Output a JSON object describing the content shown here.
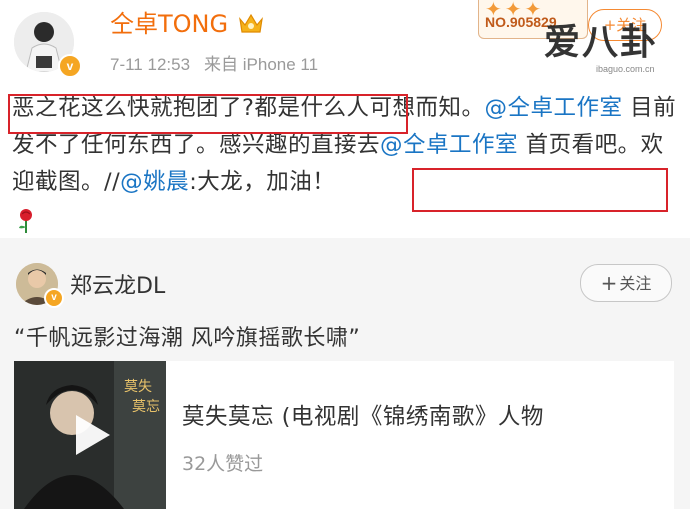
{
  "header": {
    "username": "仝卓TONG",
    "timestamp": "7-11 12:53",
    "source": "来自 iPhone 11",
    "verified_badge": "v",
    "fan_card_number": "NO.905829",
    "follow_label": "+关注"
  },
  "watermark": {
    "text": "爱八卦",
    "url": "ibaguo.com.cn"
  },
  "post": {
    "text_part1": "恶之花这么快就抱团了?都是什么人可想而知。",
    "mention_studio_1": "@仝卓工作室",
    "text_part2": " 目前发不了任何东西了。感兴趣的直接去",
    "mention_studio_2": "@仝卓工作室",
    "text_part3": " 首页看吧。欢迎截图。//",
    "mention_yaochen": "@姚晨",
    "text_part4": ":大龙，加油！"
  },
  "shared_post": {
    "username": "郑云龙DL",
    "verified_badge": "v",
    "follow_label": "关注",
    "follow_plus": "+",
    "quote": "“千帆远影过海潮  风吟旗摇歌长啸”",
    "music": {
      "title": "莫失莫忘 (电视剧《锦绣南歌》人物",
      "likes": "32人赞过"
    }
  },
  "colors": {
    "username_orange": "#f26e0c",
    "mention_blue": "#1a75c4",
    "highlight_red": "#d8232a",
    "card_bg": "#f5f5f5"
  },
  "icons": [
    "crown-icon",
    "verified-icon",
    "rose-icon",
    "play-icon"
  ]
}
